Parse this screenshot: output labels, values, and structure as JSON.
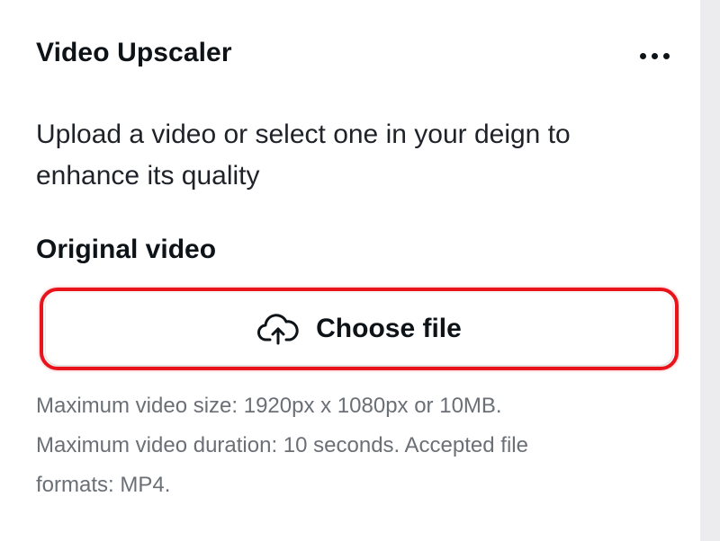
{
  "header": {
    "title": "Video Upscaler",
    "more_icon": "more-horizontal-icon"
  },
  "description": {
    "line1": "Upload a video or select one in your deign to",
    "line2": "enhance its quality"
  },
  "section": {
    "label": "Original video"
  },
  "upload": {
    "button_label": "Choose file",
    "icon": "cloud-upload-icon"
  },
  "help": {
    "line1": "Maximum video size: 1920px x 1080px or 10MB.",
    "line2": "Maximum video duration: 10 seconds. Accepted file",
    "line3": "formats: MP4."
  },
  "colors": {
    "highlight": "#e8131b",
    "text_primary": "#0e1318",
    "text_secondary": "#6b6f76"
  }
}
